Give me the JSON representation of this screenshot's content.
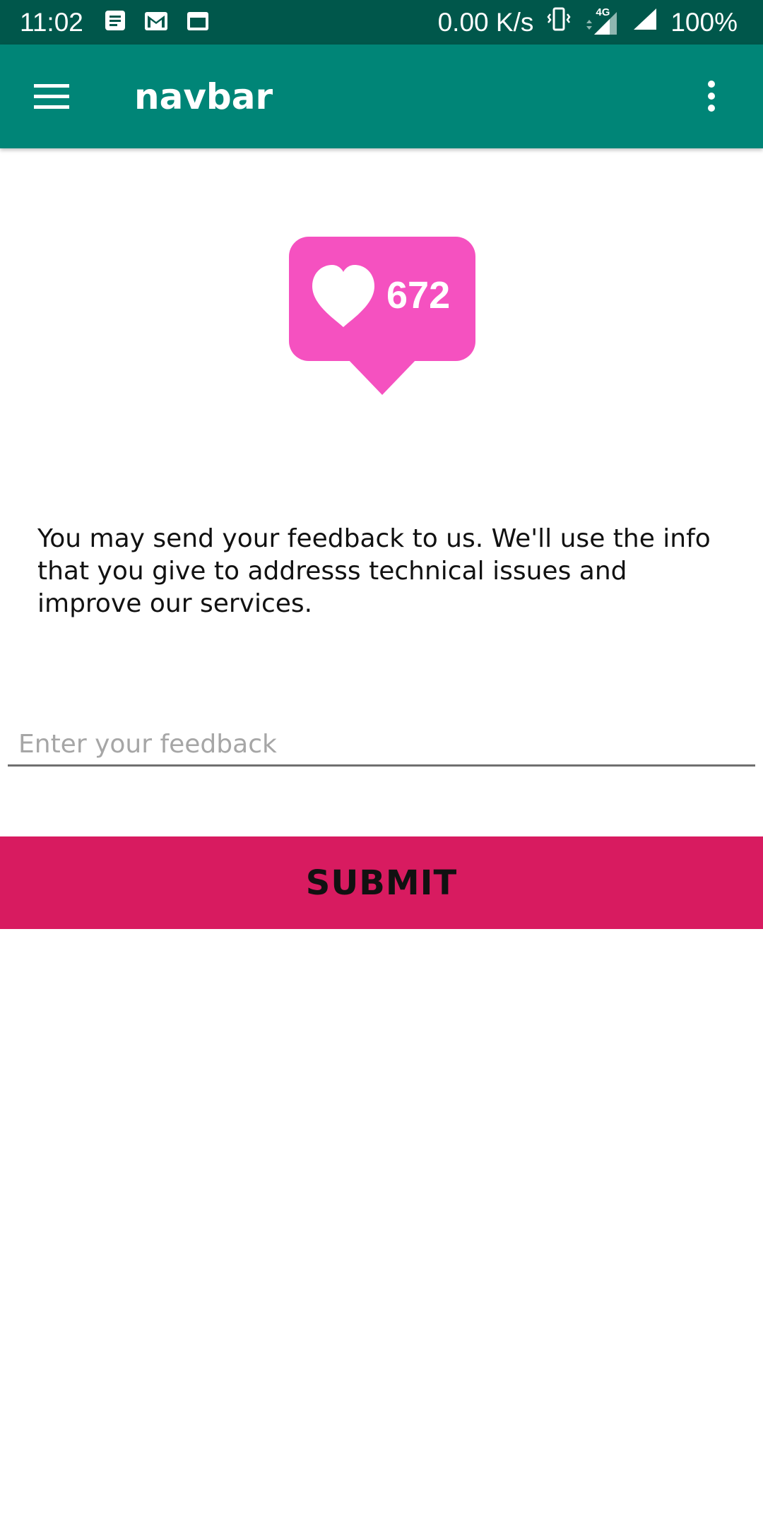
{
  "status_bar": {
    "time": "11:02",
    "net_speed": "0.00 K/s",
    "network_type": "4G",
    "battery": "100%",
    "icons": [
      "notes-icon",
      "gmail-icon",
      "window-icon",
      "vibrate-icon",
      "signal-4g-icon",
      "signal-icon"
    ]
  },
  "app_bar": {
    "title": "navbar",
    "color": "#008577",
    "status_color": "#00574b"
  },
  "like_badge": {
    "count": "672",
    "color": "#f551c0",
    "icon": "heart-icon"
  },
  "info_text": "You may send your feedback to us. We'll  use the info that you give to addresss technical issues and improve our services.",
  "feedback": {
    "placeholder": "Enter your feedback",
    "value": ""
  },
  "submit": {
    "label": "SUBMIT",
    "color": "#d81b60"
  }
}
